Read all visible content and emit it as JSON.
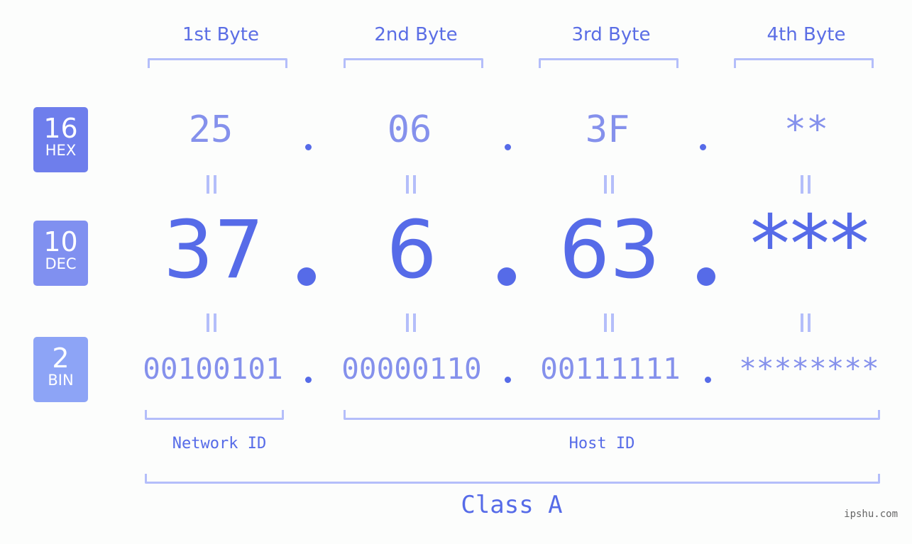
{
  "badges": [
    {
      "number": "16",
      "label": "HEX",
      "color": "#6e7eec"
    },
    {
      "number": "10",
      "label": "DEC",
      "color": "#8090f0"
    },
    {
      "number": "2",
      "label": "BIN",
      "color": "#8da4f6"
    }
  ],
  "bytes": [
    {
      "header": "1st Byte",
      "hex": "25",
      "dec": "37",
      "bin": "00100101"
    },
    {
      "header": "2nd Byte",
      "hex": "06",
      "dec": "6",
      "bin": "00000110"
    },
    {
      "header": "3rd Byte",
      "hex": "3F",
      "dec": "63",
      "bin": "00111111"
    },
    {
      "header": "4th Byte",
      "hex": "**",
      "dec": "***",
      "bin": "********"
    }
  ],
  "network_id_label": "Network ID",
  "host_id_label": "Host ID",
  "class_label": "Class A",
  "watermark": "ipshu.com",
  "colors": {
    "accent": "#566be8",
    "light_text": "#8591ec",
    "bracket": "#b4befa",
    "background": "#fcfdfc"
  }
}
